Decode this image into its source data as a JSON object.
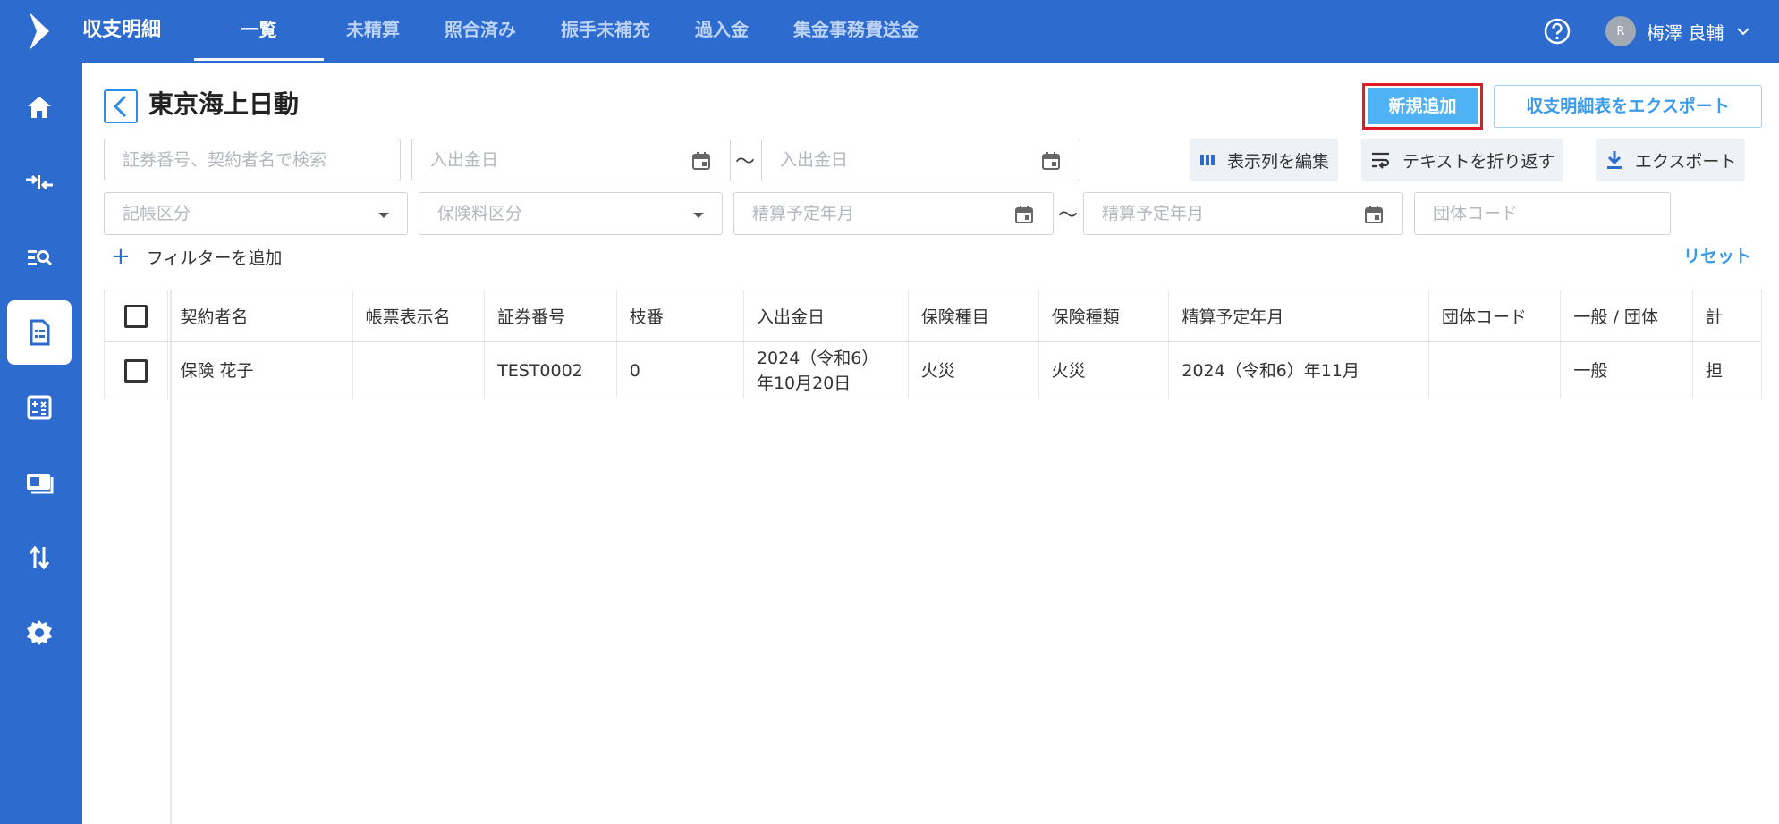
{
  "app": {
    "title": "収支明細"
  },
  "tabs": [
    {
      "label": "一覧",
      "active": true
    },
    {
      "label": "未精算"
    },
    {
      "label": "照合済み"
    },
    {
      "label": "振手未補充"
    },
    {
      "label": "過入金"
    },
    {
      "label": "集金事務費送金"
    }
  ],
  "user": {
    "initial": "R",
    "name": "梅澤 良輔"
  },
  "sidebar": {
    "items": [
      {
        "icon": "home-icon"
      },
      {
        "icon": "arrows-merge-icon"
      },
      {
        "icon": "list-search-icon"
      },
      {
        "icon": "document-list-icon",
        "active": true
      },
      {
        "icon": "calculator-icon"
      },
      {
        "icon": "money-icon"
      },
      {
        "icon": "up-down-arrows-icon"
      },
      {
        "icon": "gear-icon"
      }
    ]
  },
  "page": {
    "title": "東京海上日動"
  },
  "actions": {
    "new_label": "新規追加",
    "export_report_label": "収支明細表をエクスポート"
  },
  "filters": {
    "search_placeholder": "証券番号、契約者名で検索",
    "deposit_date_from": "入出金日",
    "deposit_date_to": "入出金日",
    "tilde": "〜",
    "entry_type": "記帳区分",
    "premium_type": "保険料区分",
    "settle_month_from": "精算予定年月",
    "settle_month_to": "精算予定年月",
    "group_code": "団体コード",
    "add_filter_label": "フィルターを追加",
    "reset_label": "リセット"
  },
  "tools": {
    "edit_columns": "表示列を編集",
    "wrap_text": "テキストを折り返す",
    "export": "エクスポート"
  },
  "table": {
    "headers": [
      "契約者名",
      "帳票表示名",
      "証券番号",
      "枝番",
      "入出金日",
      "保険種目",
      "保険種類",
      "精算予定年月",
      "団体コード",
      "一般 / 団体",
      "計"
    ],
    "rows": [
      {
        "contractor": "保険 花子",
        "display_name": "",
        "policy_no": "TEST0002",
        "branch_no": "0",
        "deposit_date": "2024（令和6）年10月20日",
        "category": "火災",
        "type": "火災",
        "settle_month": "2024（令和6）年11月",
        "group_code": "",
        "general_group": "一般",
        "extra": "担"
      }
    ]
  }
}
